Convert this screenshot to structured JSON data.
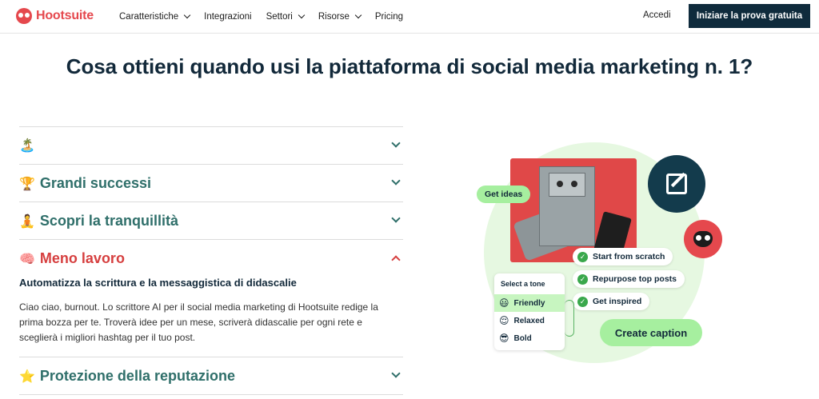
{
  "nav": {
    "logo": "Hootsuite",
    "items": [
      {
        "label": "Caratteristiche",
        "dropdown": true
      },
      {
        "label": "Integrazioni",
        "dropdown": false
      },
      {
        "label": "Settori",
        "dropdown": true
      },
      {
        "label": "Risorse",
        "dropdown": true
      },
      {
        "label": "Pricing",
        "dropdown": false
      }
    ],
    "login": "Accedi",
    "cta": "Iniziare la prova gratuita"
  },
  "headline": "Cosa ottieni quando usi la piattaforma di social media marketing n. 1?",
  "accordion": {
    "items": [
      {
        "emoji": "🏝️",
        "title": ""
      },
      {
        "emoji": "🏆",
        "title": "Grandi successi"
      },
      {
        "emoji": "🧘",
        "title": "Scopri la tranquillità"
      },
      {
        "emoji": "🧠",
        "title": "Meno lavoro",
        "open": true
      },
      {
        "emoji": "⭐",
        "title": "Protezione della reputazione"
      }
    ],
    "open_panel": {
      "heading": "Automatizza la scrittura e la messaggistica di didascalie",
      "body": "Ciao ciao, burnout. Lo scrittore AI per il social media marketing di Hootsuite redige la prima bozza per te. Troverà idee per un mese, scriverà didascalie per ogni rete e sceglierà i migliori hashtag per il tuo post."
    }
  },
  "illustration": {
    "get_ideas": "Get ideas",
    "options": [
      "Start from scratch",
      "Repurpose top posts",
      "Get inspired"
    ],
    "tone_title": "Select a tone",
    "tones": [
      {
        "emoji": "😃",
        "label": "Friendly",
        "selected": true
      },
      {
        "emoji": "😌",
        "label": "Relaxed",
        "selected": false
      },
      {
        "emoji": "😎",
        "label": "Bold",
        "selected": false
      }
    ],
    "create_caption": "Create caption"
  }
}
